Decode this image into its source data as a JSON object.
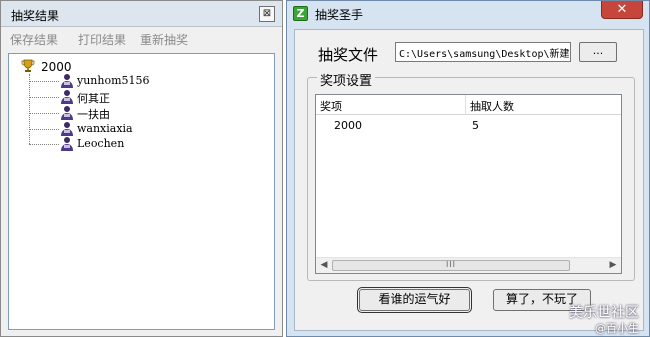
{
  "results_window": {
    "title": "抽奖结果",
    "close_glyph": "⊠",
    "menu": [
      "保存结果",
      "打印结果",
      "重新抽奖"
    ],
    "tree": {
      "root_icon": "trophy-icon",
      "root_label": "2000",
      "item_icon": "person-icon",
      "items": [
        "yunhom5156",
        "何其正",
        "一扶由",
        "wanxiaxia",
        "Leochen"
      ]
    }
  },
  "lottery_window": {
    "title": "抽奖圣手",
    "app_icon": "app-icon",
    "close_glyph": "✕",
    "file_label": "抽奖文件",
    "file_path": "C:\\Users\\samsung\\Desktop\\新建",
    "browse_label": "...",
    "group_title": "奖项设置",
    "columns": [
      "奖项",
      "抽取人数"
    ],
    "rows": [
      {
        "prize": "2000",
        "count": "5"
      }
    ],
    "scroll_thumb": "III",
    "luck_button": "看谁的运气好",
    "quit_button": "算了，不玩了",
    "watermark": "美乐世社区",
    "watermark_sub": "@百小生"
  }
}
